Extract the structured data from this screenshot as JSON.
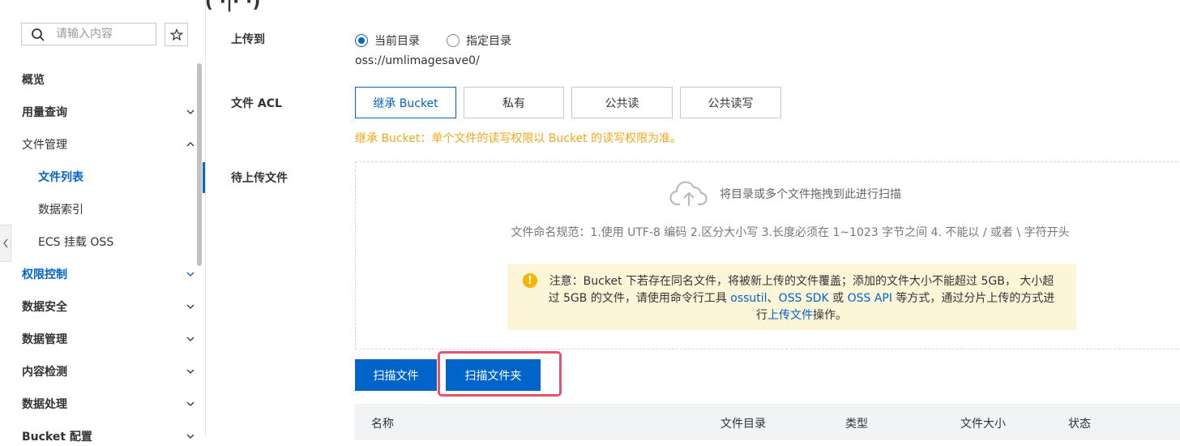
{
  "header": {
    "clipped_title": "g        · [  ]|  ( ·|· ·)"
  },
  "sidebar": {
    "search_placeholder": "请输入内容",
    "items": [
      {
        "label": "概览"
      },
      {
        "label": "用量查询"
      },
      {
        "label": "文件管理"
      },
      {
        "label": "文件列表"
      },
      {
        "label": "数据索引"
      },
      {
        "label": "ECS 挂载 OSS"
      },
      {
        "label": "权限控制"
      },
      {
        "label": "数据安全"
      },
      {
        "label": "数据管理"
      },
      {
        "label": "内容检测"
      },
      {
        "label": "数据处理"
      },
      {
        "label": "Bucket 配置"
      }
    ]
  },
  "form": {
    "upload_to_label": "上传到",
    "radio_current": "当前目录",
    "radio_specified": "指定目录",
    "oss_path": "oss://umlimagesave0/",
    "acl_label": "文件 ACL",
    "acl_options": [
      "继承 Bucket",
      "私有",
      "公共读",
      "公共读写"
    ],
    "acl_hint": "继承 Bucket：单个文件的读写权限以 Bucket 的读写权限为准。",
    "pending_label": "待上传文件",
    "drop_text": "将目录或多个文件拖拽到此进行扫描",
    "naming_rule": "文件命名规范：1.使用 UTF-8 编码 2.区分大小写 3.长度必须在 1~1023 字节之间 4. 不能以 / 或者 \\ 字符开头",
    "notice_part1": "注意：Bucket 下若存在同名文件，将被新上传的文件覆盖；添加的文件大小不能超过 5GB， 大小超过 5GB 的文件，请使用命令行工具 ",
    "notice_link1": "ossutil",
    "notice_sep1": "、",
    "notice_link2": "OSS SDK",
    "notice_sep2": " 或 ",
    "notice_link3": "OSS API",
    "notice_part2": " 等方式，通过分片上传的方式进行",
    "notice_link4": "上传文件",
    "notice_part3": "操作。",
    "scan_files": "扫描文件",
    "scan_folder": "扫描文件夹"
  },
  "table": {
    "columns": [
      "名称",
      "文件目录",
      "类型",
      "文件大小",
      "状态"
    ]
  }
}
